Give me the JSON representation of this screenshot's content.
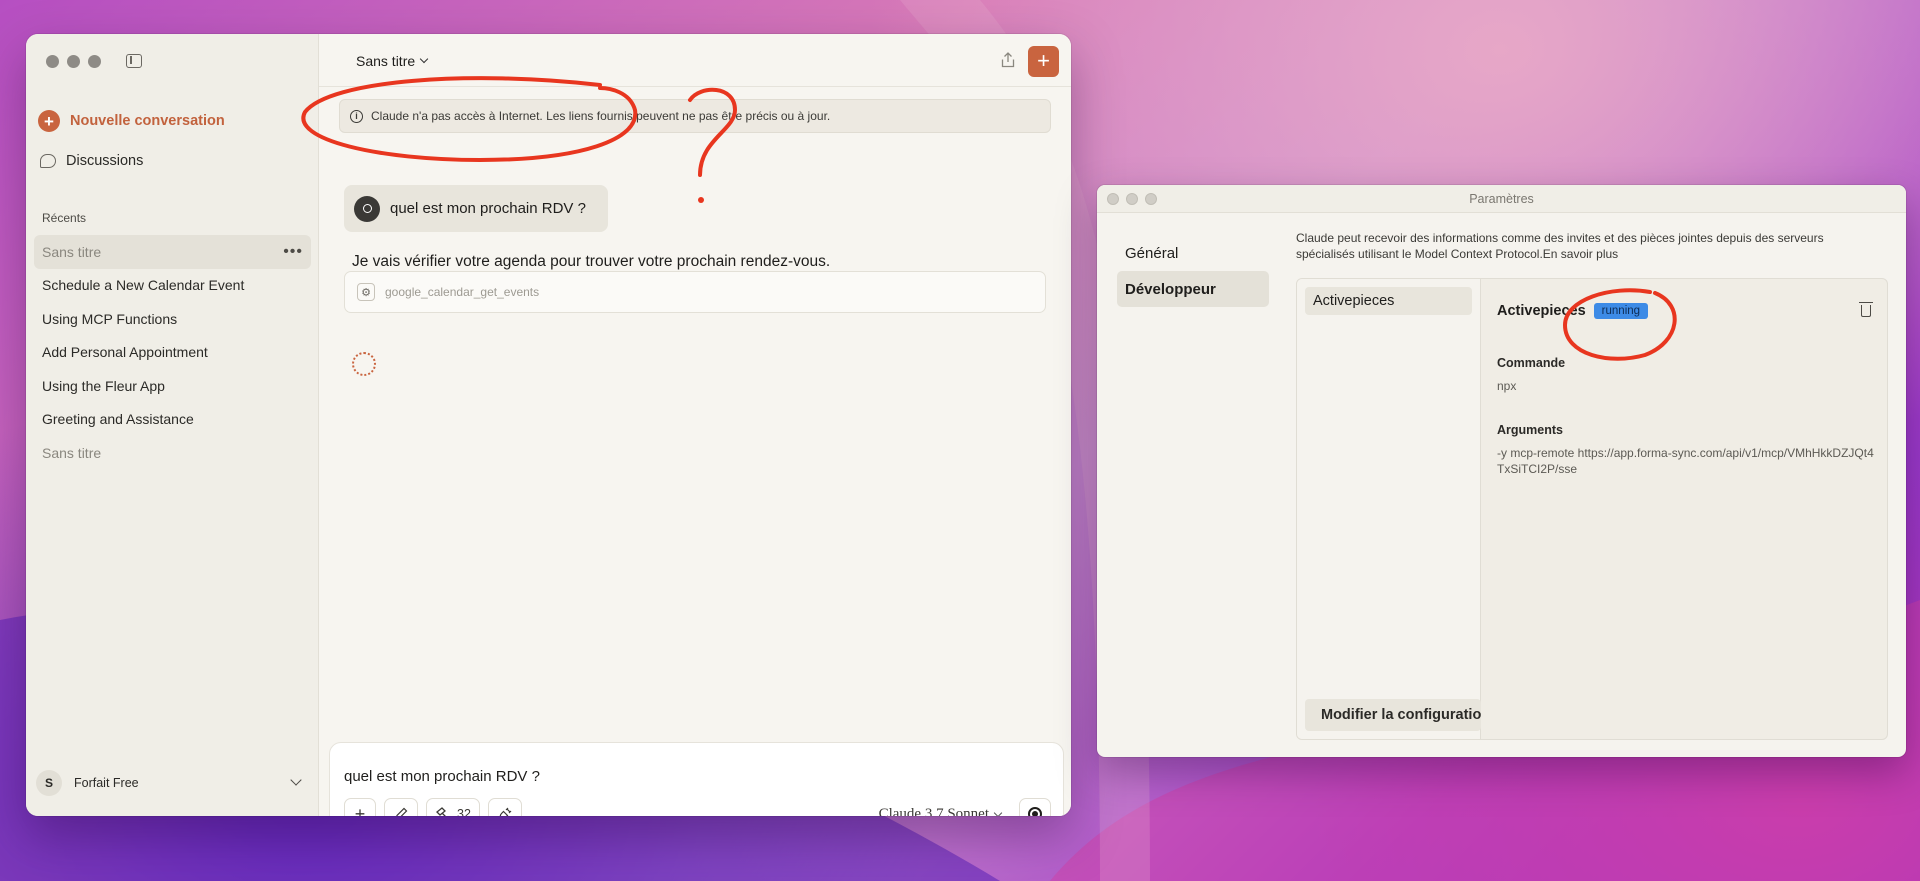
{
  "sidebar": {
    "new_conversation": "Nouvelle conversation",
    "discussions": "Discussions",
    "recents_label": "Récents",
    "recents": [
      {
        "label": "Sans titre"
      },
      {
        "label": "Schedule a New Calendar Event"
      },
      {
        "label": "Using MCP Functions"
      },
      {
        "label": "Add Personal Appointment"
      },
      {
        "label": "Using the Fleur App"
      },
      {
        "label": "Greeting and Assistance"
      },
      {
        "label": "Sans titre"
      }
    ],
    "plan_initial": "S",
    "plan_label": "Forfait Free"
  },
  "chat": {
    "title": "Sans titre",
    "notice": "Claude n'a pas accès à Internet. Les liens fournis peuvent ne pas être précis ou à jour.",
    "user_message": "quel est mon prochain RDV ?",
    "assistant_message": "Je vais vérifier votre agenda pour trouver votre prochain rendez-vous.",
    "tool_call": "google_calendar_get_events"
  },
  "composer": {
    "text": "quel est mon prochain RDV ?",
    "tools_count": "32",
    "model": "Claude 3.7 Sonnet"
  },
  "settings": {
    "window_title": "Paramètres",
    "nav": [
      {
        "label": "Général"
      },
      {
        "label": "Développeur"
      }
    ],
    "description": "Claude peut recevoir des informations comme des invites et des pièces jointes depuis des serveurs spécialisés utilisant le Model Context Protocol.En savoir plus",
    "server_list_item": "Activepieces",
    "server_name": "Activepieces",
    "status": "running",
    "command_label": "Commande",
    "command_value": "npx",
    "args_label": "Arguments",
    "args_value": "-y mcp-remote https://app.forma-sync.com/api/v1/mcp/VMhHkkDZJQt4TxSiTCI2P/sse",
    "edit_button": "Modifier la configuration"
  },
  "colors": {
    "accent": "#c9643f",
    "status_running": "#3d8be6",
    "annotation": "#e8361f"
  }
}
